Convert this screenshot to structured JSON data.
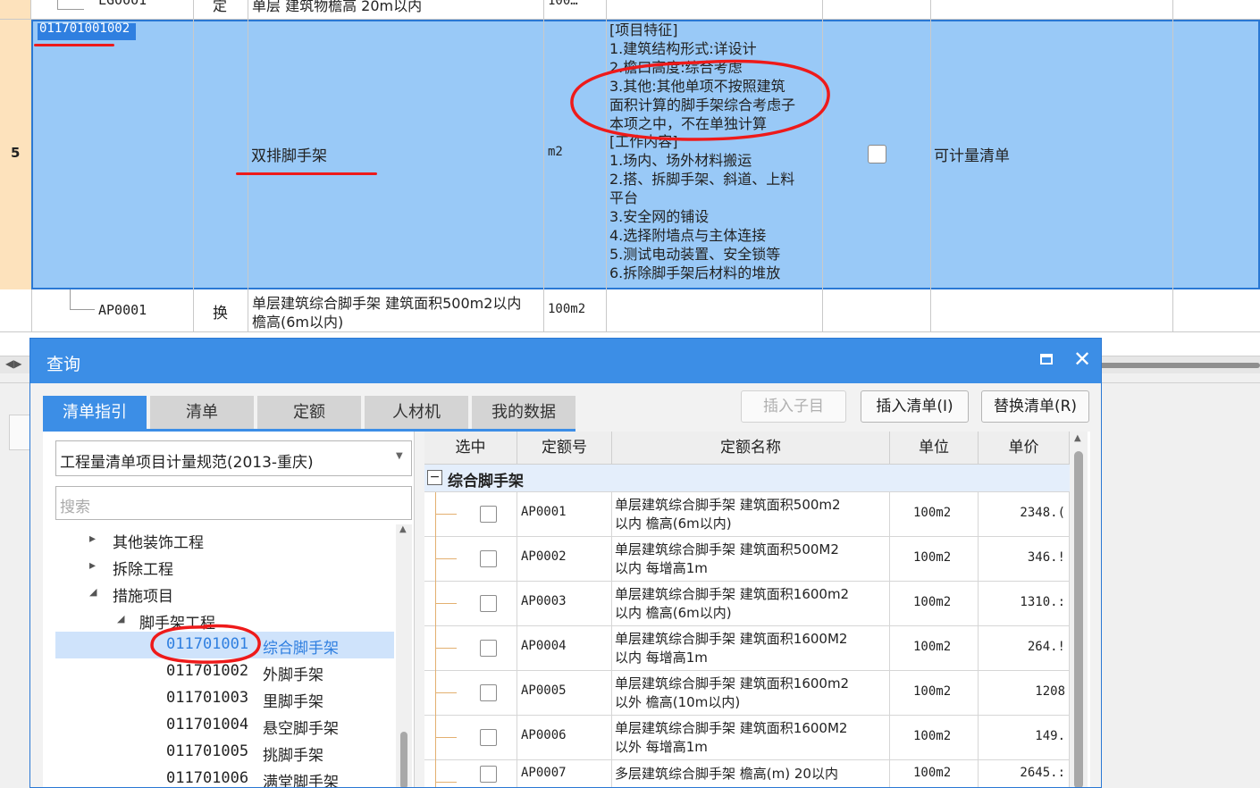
{
  "spreadsheet": {
    "prev_row": {
      "code": "LG0001",
      "type": "定",
      "name": "单层 建筑物檐高 20m以内",
      "unit": "100…"
    },
    "selected_row": {
      "row_number": "5",
      "code": "011701001002",
      "name": "双排脚手架",
      "unit": "m2",
      "features": [
        "[项目特征]",
        "1.建筑结构形式:详设计",
        "2.檐口高度:综合考虑",
        "3.其他:其他单项不按照建筑",
        "面积计算的脚手架综合考虑子",
        "本项之中，不在单独计算",
        "[工作内容]",
        "1.场内、场外材料搬运",
        "2.搭、拆脚手架、斜道、上料",
        "平台",
        "3.安全网的铺设",
        "4.选择附墙点与主体连接",
        "5.测试电动装置、安全锁等",
        "6.拆除脚手架后材料的堆放"
      ],
      "checkbox_checked": false,
      "category": "可计量清单"
    },
    "child_row": {
      "code": "AP0001",
      "type": "换",
      "name_line1": "单层建筑综合脚手架 建筑面积500m2以内",
      "name_line2": "檐高(6m以内)",
      "unit": "100m2"
    }
  },
  "dialog": {
    "title": "查询",
    "tabs": [
      "清单指引",
      "清单",
      "定额",
      "人材机",
      "我的数据"
    ],
    "active_tab": 0,
    "buttons": {
      "insert_child": "插入子目",
      "insert_list": "插入清单(I)",
      "replace_list": "替换清单(R)"
    },
    "spec_select": "工程量清单项目计量规范(2013-重庆)",
    "search_placeholder": "搜索",
    "tree": {
      "items": [
        {
          "label": "其他装饰工程",
          "arrow": "▸"
        },
        {
          "label": "拆除工程",
          "arrow": "▸"
        },
        {
          "label": "措施项目",
          "arrow": "◢"
        },
        {
          "label": "脚手架工程",
          "arrow": "◢"
        }
      ],
      "leaves": [
        {
          "code": "011701001",
          "name": "综合脚手架",
          "selected": true
        },
        {
          "code": "011701002",
          "name": "外脚手架"
        },
        {
          "code": "011701003",
          "name": "里脚手架"
        },
        {
          "code": "011701004",
          "name": "悬空脚手架"
        },
        {
          "code": "011701005",
          "name": "挑脚手架"
        },
        {
          "code": "011701006",
          "name": "满堂脚手架"
        }
      ]
    },
    "table": {
      "headers": [
        "选中",
        "定额号",
        "定额名称",
        "单位",
        "单价"
      ],
      "group_label": "综合脚手架",
      "group_toggle": "−",
      "rows": [
        {
          "code": "AP0001",
          "name1": "单层建筑综合脚手架 建筑面积500m2",
          "name2": "以内 檐高(6m以内)",
          "unit": "100m2",
          "price": "2348.("
        },
        {
          "code": "AP0002",
          "name1": "单层建筑综合脚手架 建筑面积500M2",
          "name2": "以内 每增高1m",
          "unit": "100m2",
          "price": "346.!"
        },
        {
          "code": "AP0003",
          "name1": "单层建筑综合脚手架 建筑面积1600m2",
          "name2": "以内 檐高(6m以内)",
          "unit": "100m2",
          "price": "1310.:"
        },
        {
          "code": "AP0004",
          "name1": "单层建筑综合脚手架 建筑面积1600M2",
          "name2": "以内 每增高1m",
          "unit": "100m2",
          "price": "264.!"
        },
        {
          "code": "AP0005",
          "name1": "单层建筑综合脚手架 建筑面积1600m2",
          "name2": "以外 檐高(10m以内)",
          "unit": "100m2",
          "price": "1208"
        },
        {
          "code": "AP0006",
          "name1": "单层建筑综合脚手架 建筑面积1600M2",
          "name2": "以外 每增高1m",
          "unit": "100m2",
          "price": "149."
        },
        {
          "code": "AP0007",
          "name1": "多层建筑综合脚手架 檐高(m) 20以内",
          "name2": "",
          "unit": "100m2",
          "price": "2645.:"
        }
      ]
    }
  },
  "colors": {
    "accent": "#3c8ee6",
    "selection": "#99c9f7",
    "annotation": "#ee1a1a",
    "row_header": "#fde2bc"
  }
}
